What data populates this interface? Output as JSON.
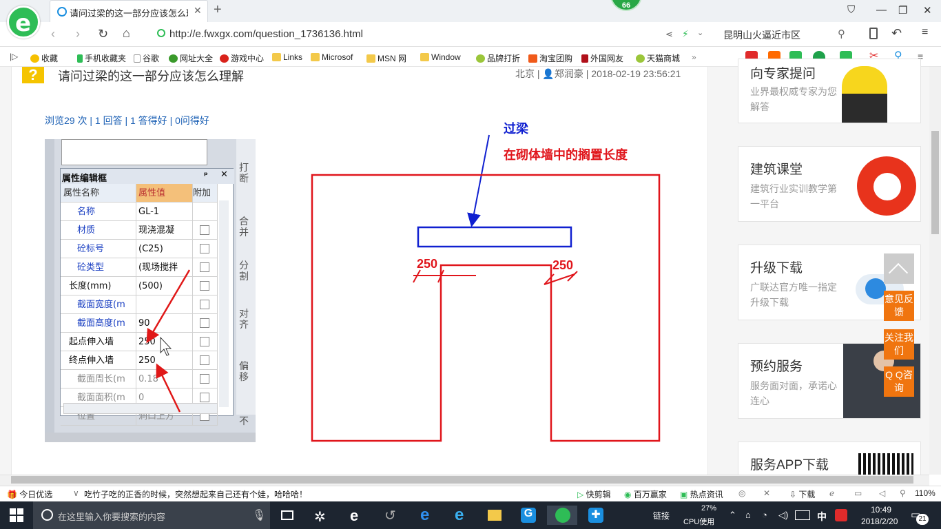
{
  "browser": {
    "tab_title": "请问过梁的这一部分应该怎么理解",
    "badge_count": "66",
    "url": "http://e.fwxgx.com/question_1736136.html",
    "search_box": "昆明山火逼近市区"
  },
  "bookmarks": [
    "收藏",
    "手机收藏夹",
    "谷歌",
    "网址大全",
    "游戏中心",
    "Links",
    "Microsof",
    "MSN 网",
    "Window",
    "品牌打折",
    "淘宝团购",
    "外国网友",
    "天猫商城"
  ],
  "question": {
    "title": "请问过梁的这一部分应该怎么理解",
    "location": "北京",
    "user": "郑润豪",
    "time": "2018-02-19 23:56:21",
    "views": "浏览29 次",
    "answers": "1 回答",
    "good_answers": "1 答得好",
    "good_questions": "0问得好"
  },
  "property_panel": {
    "title": "属性编辑框",
    "headers": [
      "属性名称",
      "属性值",
      "附加"
    ],
    "rows": [
      {
        "name": "名称",
        "value": "GL-1",
        "style": "blue",
        "checkbox": false
      },
      {
        "name": "材质",
        "value": "现浇混凝",
        "style": "blue",
        "checkbox": true
      },
      {
        "name": "砼标号",
        "value": "(C25)",
        "style": "blue",
        "checkbox": true
      },
      {
        "name": "砼类型",
        "value": "(现场搅拌",
        "style": "blue",
        "checkbox": true
      },
      {
        "name": "长度(mm)",
        "value": "(500)",
        "style": "black",
        "checkbox": true
      },
      {
        "name": "截面宽度(m",
        "value": "",
        "style": "blue",
        "checkbox": true
      },
      {
        "name": "截面高度(m",
        "value": "90",
        "style": "blue",
        "checkbox": true
      },
      {
        "name": "起点伸入墙",
        "value": "250",
        "style": "black",
        "checkbox": true
      },
      {
        "name": "终点伸入墙",
        "value": "250",
        "style": "black",
        "checkbox": true
      },
      {
        "name": "截面周长(m",
        "value": "0.18",
        "style": "gray",
        "checkbox": true
      },
      {
        "name": "截面面积(m",
        "value": "0",
        "style": "gray",
        "checkbox": true
      },
      {
        "name": "位置",
        "value": "洞口上方",
        "style": "gray",
        "checkbox": true
      }
    ],
    "side_buttons": [
      "打断",
      "合并",
      "分割",
      "对齐",
      "偏移"
    ],
    "side_bottom": "不"
  },
  "drawing": {
    "label_lintel": "过梁",
    "label_bearing": "在砌体墙中的搁置长度",
    "dim_left": "250",
    "dim_right": "250"
  },
  "sidebar": {
    "cards": [
      {
        "title": "向专家提问",
        "desc": "业界最权威专家为您解答"
      },
      {
        "title": "建筑课堂",
        "desc": "建筑行业实训教学第一平台"
      },
      {
        "title": "升级下载",
        "desc": "广联达官方唯一指定升级下载"
      },
      {
        "title": "预约服务",
        "desc": "服务面对面，承诺心连心"
      },
      {
        "title": "服务APP下载",
        "desc": ""
      }
    ],
    "float_buttons": [
      "意见反馈",
      "关注我们",
      "Q Q咨询"
    ]
  },
  "statusbar": {
    "left": "今日优选",
    "news": "吃竹子吃的正香的时候，突然想起来自己还有个娃，哈哈哈！",
    "items": [
      "快剪辑",
      "百万赢家",
      "热点资讯",
      "下载"
    ],
    "zoom": "110%"
  },
  "taskbar": {
    "search_placeholder": "在这里输入你要搜索的内容",
    "link_label": "链接",
    "cpu_percent": "27%",
    "cpu_label": "CPU使用",
    "ime": "中",
    "time": "10:49",
    "date": "2018/2/20",
    "notifications": "21"
  },
  "colors": {
    "accent_green": "#2ebd56",
    "link_blue": "#1a5fb4",
    "drawing_red": "#e0151b",
    "drawing_blue": "#1020d0",
    "float_orange": "#f0750f"
  }
}
